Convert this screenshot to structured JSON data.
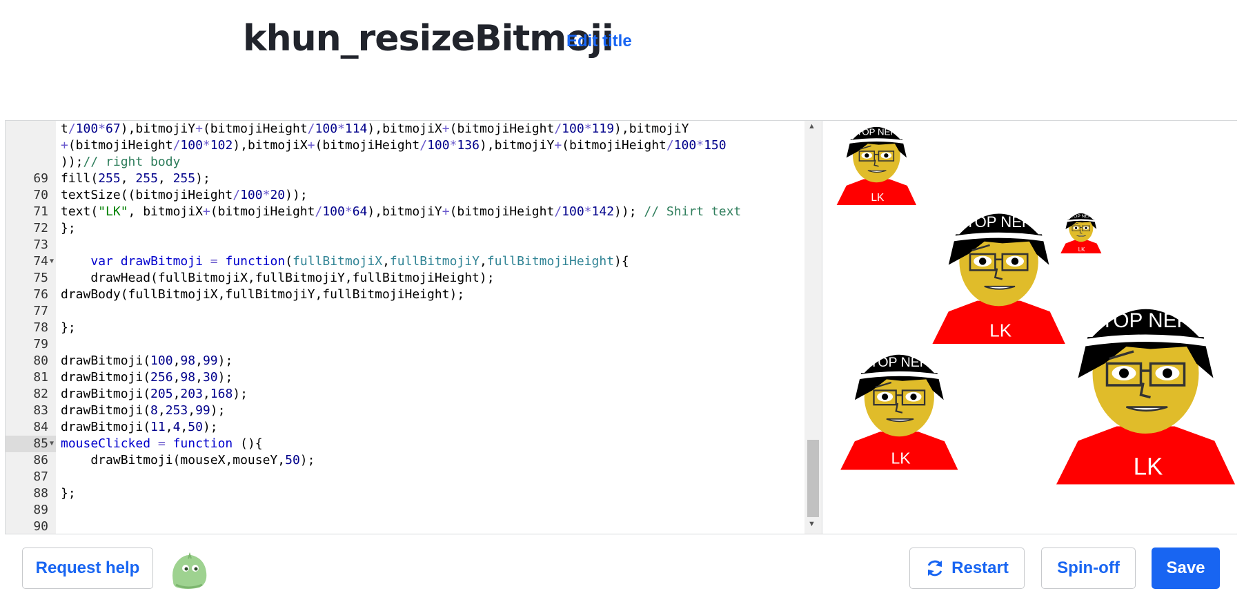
{
  "header": {
    "title": "khun_resizeBitmoji",
    "edit_title": "Edit title"
  },
  "editor": {
    "lines": [
      {
        "n": "",
        "html": "t<span class=\"op\">/</span><span class=\"num\">100</span><span class=\"op\">*</span><span class=\"num\">67</span>),bitmojiY<span class=\"op\">+</span>(bitmojiHeight<span class=\"op\">/</span><span class=\"num\">100</span><span class=\"op\">*</span><span class=\"num\">114</span>),bitmojiX<span class=\"op\">+</span>(bitmojiHeight<span class=\"op\">/</span><span class=\"num\">100</span><span class=\"op\">*</span><span class=\"num\">119</span>),bitmojiY"
      },
      {
        "n": "",
        "html": "<span class=\"op\">+</span>(bitmojiHeight<span class=\"op\">/</span><span class=\"num\">100</span><span class=\"op\">*</span><span class=\"num\">102</span>),bitmojiX<span class=\"op\">+</span>(bitmojiHeight<span class=\"op\">/</span><span class=\"num\">100</span><span class=\"op\">*</span><span class=\"num\">136</span>),bitmojiY<span class=\"op\">+</span>(bitmojiHeight<span class=\"op\">/</span><span class=\"num\">100</span><span class=\"op\">*</span><span class=\"num\">150</span>"
      },
      {
        "n": "",
        "html": "));<span class=\"cm\">// right body</span>"
      },
      {
        "n": "69",
        "html": "fill(<span class=\"num\">255</span>, <span class=\"num\">255</span>, <span class=\"num\">255</span>);"
      },
      {
        "n": "70",
        "html": "textSize((bitmojiHeight<span class=\"op\">/</span><span class=\"num\">100</span><span class=\"op\">*</span><span class=\"num\">20</span>));"
      },
      {
        "n": "71",
        "html": "text(<span class=\"str\">\"LK\"</span>, bitmojiX<span class=\"op\">+</span>(bitmojiHeight<span class=\"op\">/</span><span class=\"num\">100</span><span class=\"op\">*</span><span class=\"num\">64</span>),bitmojiY<span class=\"op\">+</span>(bitmojiHeight<span class=\"op\">/</span><span class=\"num\">100</span><span class=\"op\">*</span><span class=\"num\">142</span>)); <span class=\"cm\">// Shirt text</span>"
      },
      {
        "n": "72",
        "html": "};"
      },
      {
        "n": "73",
        "html": ""
      },
      {
        "n": "74",
        "fold": true,
        "html": "    <span class=\"kw\">var</span> <span class=\"kw\">drawBitmoji</span> <span class=\"op\">=</span> <span class=\"kw\">function</span>(<span class=\"var\">fullBitmojiX</span>,<span class=\"var\">fullBitmojiY</span>,<span class=\"var\">fullBitmojiHeight</span>){"
      },
      {
        "n": "75",
        "html": "    drawHead(fullBitmojiX,fullBitmojiY,fullBitmojiHeight);"
      },
      {
        "n": "76",
        "html": "drawBody(fullBitmojiX,fullBitmojiY,fullBitmojiHeight);"
      },
      {
        "n": "77",
        "html": ""
      },
      {
        "n": "78",
        "html": "};"
      },
      {
        "n": "79",
        "html": ""
      },
      {
        "n": "80",
        "html": "drawBitmoji(<span class=\"num\">100</span>,<span class=\"num\">98</span>,<span class=\"num\">99</span>);"
      },
      {
        "n": "81",
        "html": "drawBitmoji(<span class=\"num\">256</span>,<span class=\"num\">98</span>,<span class=\"num\">30</span>);"
      },
      {
        "n": "82",
        "html": "drawBitmoji(<span class=\"num\">205</span>,<span class=\"num\">203</span>,<span class=\"num\">168</span>);"
      },
      {
        "n": "83",
        "html": "drawBitmoji(<span class=\"num\">8</span>,<span class=\"num\">253</span>,<span class=\"num\">99</span>);"
      },
      {
        "n": "84",
        "html": "drawBitmoji(<span class=\"num\">11</span>,<span class=\"num\">4</span>,<span class=\"num\">50</span>);"
      },
      {
        "n": "85",
        "fold": true,
        "active": true,
        "html": "<span class=\"kw\">mouseClicked</span> <span class=\"op\">=</span> <span class=\"kw\">function</span> (){"
      },
      {
        "n": "86",
        "html": "    drawBitmoji(mouseX,mouseY,<span class=\"num\">50</span>);"
      },
      {
        "n": "87",
        "html": ""
      },
      {
        "n": "88",
        "html": "};"
      },
      {
        "n": "89",
        "html": ""
      },
      {
        "n": "90",
        "html": ""
      }
    ]
  },
  "canvas": {
    "hat_text": "TOP NEP",
    "shirt_text": "LK",
    "colors": {
      "skin": "#e0bc2a",
      "shirt": "#ff0000",
      "hat": "#000000",
      "hat_band": "#ffffff",
      "hair": "#000000"
    }
  },
  "footer": {
    "request_help": "Request help",
    "restart": "Restart",
    "spin_off": "Spin-off",
    "save": "Save"
  },
  "icons": {
    "restart": "refresh-icon",
    "avatar": "green-blob-avatar-icon"
  }
}
